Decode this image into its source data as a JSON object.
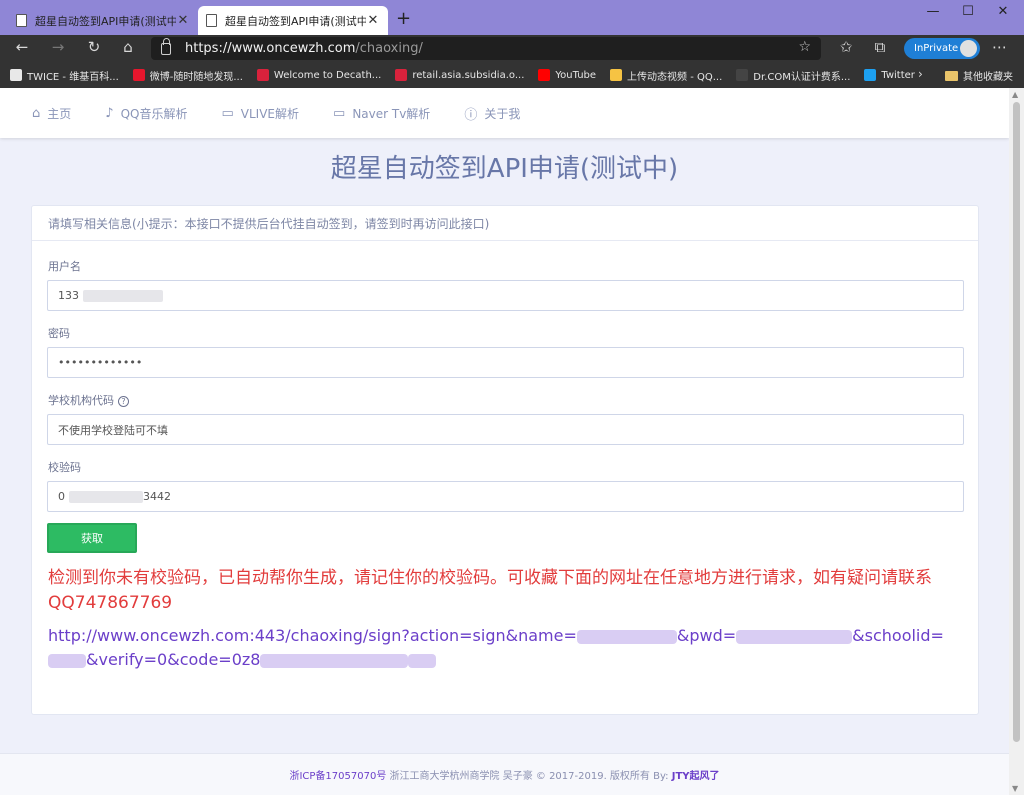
{
  "browser": {
    "tabs": [
      {
        "title": "超星自动签到API申请(测试中)",
        "active": false
      },
      {
        "title": "超星自动签到API申请(测试中)",
        "active": true
      }
    ],
    "url_host": "https://www.oncewzh.com",
    "url_path": "/chaoxing/",
    "inprivate_label": "InPrivate",
    "favorites": [
      {
        "label": "TWICE - 维基百科...",
        "color": "#e8e8e8"
      },
      {
        "label": "微博-随时随地发现...",
        "color": "#e6162d"
      },
      {
        "label": "Welcome to Decath...",
        "color": "#d9223c"
      },
      {
        "label": "retail.asia.subsidia.o...",
        "color": "#d9223c"
      },
      {
        "label": "YouTube",
        "color": "#ff0000"
      },
      {
        "label": "上传动态视频 - QQ...",
        "color": "#f6c343"
      },
      {
        "label": "Dr.COM认证计费系...",
        "color": "#444444"
      },
      {
        "label": "Twitter",
        "color": "#1da1f2"
      }
    ],
    "other_favorites": "其他收藏夹"
  },
  "nav": {
    "items": [
      {
        "label": "主页",
        "icon": "home-icon",
        "glyph": "⌂"
      },
      {
        "label": "QQ音乐解析",
        "icon": "music-note-icon",
        "glyph": "♪"
      },
      {
        "label": "VLIVE解析",
        "icon": "video-camera-icon",
        "glyph": "▭"
      },
      {
        "label": "Naver Tv解析",
        "icon": "video-camera-icon",
        "glyph": "▭"
      },
      {
        "label": "关于我",
        "icon": "info-icon",
        "glyph": "ⓘ"
      }
    ]
  },
  "page": {
    "heading": "超星自动签到API申请(测试中)",
    "card_header": "请填写相关信息(小提示：本接口不提供后台代挂自动签到，请签到时再访问此接口)",
    "fields": {
      "username": {
        "label": "用户名",
        "value": "133"
      },
      "password": {
        "label": "密码",
        "value": "•••••••••••••"
      },
      "school": {
        "label": "学校机构代码",
        "value": "不使用学校登陆可不填"
      },
      "code": {
        "label": "校验码",
        "value_start": "0",
        "value_end": "3442"
      }
    },
    "submit_label": "获取",
    "alert": "检测到你未有校验码，已自动帮你生成，请记住你的校验码。可收藏下面的网址在任意地方进行请求，如有疑问请联系QQ747867769",
    "api_url": {
      "part1": "http://www.oncewzh.com:443/chaoxing/sign?action=sign&name=",
      "part2": "&pwd=",
      "part3": "&schoolid=",
      "part4": "&verify=0&code=0z8"
    }
  },
  "footer": {
    "icp": "浙ICP备17057070号",
    "school": "浙江工商大学杭州商学院",
    "name": "吴子豪",
    "copyright": "© 2017-2019. 版权所有 By:",
    "author": "JTY起风了"
  }
}
